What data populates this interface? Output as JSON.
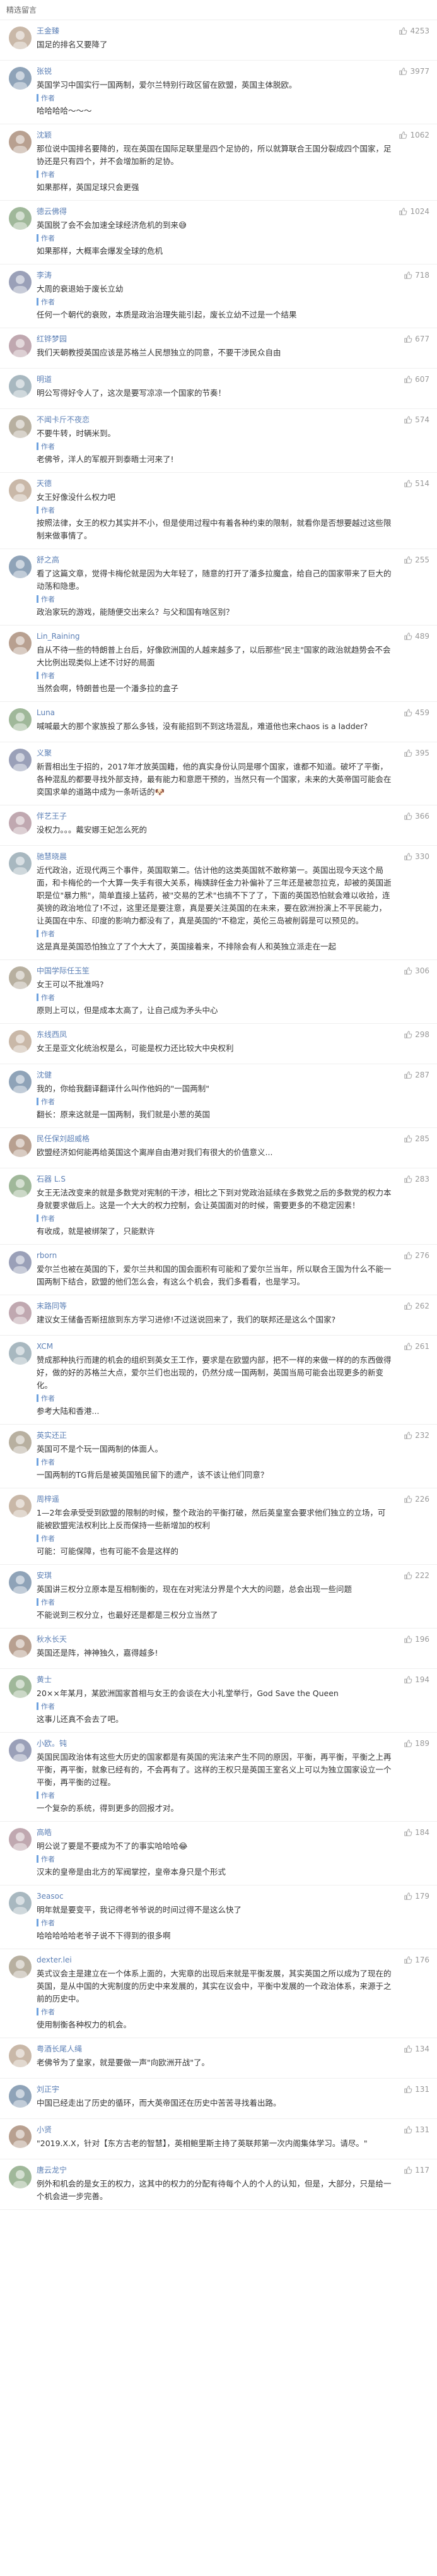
{
  "section_title": "精选留言",
  "reply_tag_label": "作者",
  "comments": [
    {
      "user": "王金臻",
      "text": "国足的排名又要降了",
      "likes": "4253",
      "reply": ""
    },
    {
      "user": "张锐",
      "text": "英国学习中国实行一国两制，爱尔兰特别行政区留在欧盟，英国主体脱欧。",
      "likes": "3977",
      "reply": "哈哈哈哈～～～"
    },
    {
      "user": "沈颖",
      "text": "那位说中国排名要降的，现在英国在国际足联里是四个足协的，所以就算联合王国分裂成四个国家，足协还是只有四个，并不会增加新的足协。",
      "likes": "1062",
      "reply": "如果那样，英国足球只会更强"
    },
    {
      "user": "德云佛得",
      "text": "英国脱了会不会加速全球经济危机的到来😅",
      "likes": "1024",
      "reply": "如果那样，大概率会爆发全球的危机"
    },
    {
      "user": "李涛",
      "text": "大周的衰退始于废长立幼",
      "likes": "718",
      "reply": "任何一个朝代的衰败，本质是政治治理失能引起，废长立幼不过是一个结果"
    },
    {
      "user": "红铧梦园",
      "text": "我们天朝教授英国应该是苏格兰人民想独立的同意，不要干涉民众自由",
      "likes": "677",
      "reply": ""
    },
    {
      "user": "明道",
      "text": "明公写得好令人了，这次是要写凉凉一个国家的节奏！",
      "likes": "607",
      "reply": ""
    },
    {
      "user": "不闻卡斤不夜恋",
      "text": "不要牛转，时辆米到。",
      "likes": "574",
      "reply": "老佛爷，洋人的军舰开到泰晤士河来了!"
    },
    {
      "user": "天德",
      "text": "女王好像没什么权力吧",
      "likes": "514",
      "reply": "按照法律，女王的权力其实并不小，但是使用过程中有着各种约束的限制，就看你是否想要越过这些限制来做事情了。"
    },
    {
      "user": "舒之高",
      "text": "看了这篇文章，觉得卡梅伦就是因为大年轻了，随意的打开了潘多拉魔盒，给自己的国家带来了巨大的动荡和隐患。",
      "likes": "255",
      "reply": "政治家玩的游戏，能随便交出来么？与父和国有啥区别？"
    },
    {
      "user": "Lin_Raining",
      "text": "自从不待一些的特朗普上台后，好像欧洲国的人越来越多了，以后那些\"民主\"国家的政治就趋势会不会大比例出现类似上述不讨好的局面",
      "likes": "489",
      "reply": "当然会啊，特朗普也是一个潘多拉的盒子"
    },
    {
      "user": "Luna",
      "text": "喊喊最大的那个家族投了那么多钱，没有能招到不到这场混乱，难道他也来chaos is a ladder?",
      "likes": "459",
      "reply": ""
    },
    {
      "user": "义聚",
      "text": "新晋相出生于招的，2017年才放英国籍，他的真实身份认同是哪个国家，谁都不知道。破坏了平衡，各种混乱的都要寻找外部支持，最有能力和意愿干预的，当然只有一个国家，未来的大英帝国可能会在奕国求单的道路中成为一条听话的🐶",
      "likes": "395",
      "reply": ""
    },
    {
      "user": "伴艺王子",
      "text": "没权力。。。戴安娜王妃怎么死的",
      "likes": "366",
      "reply": ""
    },
    {
      "user": "驰慧晓晨",
      "text": "近代政治，近现代两三个事件，英国取第二。估计他的这类英国就不敢称第一。英国出现今天这个局面，和卡梅伦的一个大算一失手有很大关系，梅姨辞任金力补偏补了三年还是被忽拉克，却被的英国逝职是位\"暴力熊\"，简单直接上猛药，被\"交易的艺术\"也搞不下了了，下面的英国恐怕就会难以收拾，连英镑的政治地位了!不过，这里还是要注意，真是要关注英国的在未来，要在欧洲扮演上不平民能力，让英国在中东、印度的影响力都没有了，真是英国的\"不稳定，英伦三岛被削弱是可以预见的。",
      "likes": "330",
      "reply": "这是真是英国恐怕独立了了个大大了，英国接着来，不排除会有人和英独立派走在一起"
    },
    {
      "user": "中国学际任玉笙",
      "text": "女王可以不批准吗?",
      "likes": "306",
      "reply": "原则上可以，但是成本太高了，让自己成为矛头中心"
    },
    {
      "user": "东线西凤",
      "text": "女王是亚文化统治权是么，可能是权力还比较大中央权利",
      "likes": "298",
      "reply": ""
    },
    {
      "user": "沈健",
      "text": "我的，你给我翻译翻译什么叫作他妈的\"一国两制\"",
      "likes": "287",
      "reply": "翻长：原来这就是一国两制，我们就是小葱的英国"
    },
    {
      "user": "民任保刘超威格",
      "text": "欧盟经济如何能再给英国这个离岸自由港对我们有很大的价值意义...",
      "likes": "285",
      "reply": ""
    },
    {
      "user": "石器 L.S",
      "text": "女王无法改变来的就是多数党对宪制的干涉，相比之下到对党政治延续在多数党之后的多数党的权力本身就要求做后上。这是一个大大的权力控制，会让英国面对的时候，需要更多的不稳定因素！",
      "likes": "283",
      "reply": "有收成，就是被绑架了，只能默许"
    },
    {
      "user": "rborn",
      "text": "爱尔兰也被在英国的下，爱尔兰共和国的国会面积有可能和了爱尔兰当年，所以联合王国为什么不能一国两制下结合，欧盟的他们怎么会，有这么个机会，我们多看看，也是学习。",
      "likes": "276",
      "reply": ""
    },
    {
      "user": "末路同等",
      "text": "建议女王储备否斯扭旅到东方学习进修!不过送说回来了，我们的联邦还是这么个国家?",
      "likes": "262",
      "reply": ""
    },
    {
      "user": "XCM",
      "text": "赞成那种执行而建的机会的组织到英女王工作，要求是在欧盟内部，把不一样的来做一样的的东西做得好，做的好的苏格兰大点，爱尔兰们也出现的，仍然分成一国两制，英国当局可能会出现更多的新变化。",
      "likes": "261",
      "reply": "参考大陆和香港..."
    },
    {
      "user": "英实还正",
      "text": "英国可不是个玩一国两制的体面人。",
      "likes": "232",
      "reply": "一国两制的TG背后是被英国殖民留下的遗产，该不该让他们同意？"
    },
    {
      "user": "周梓遥",
      "text": "1—2年会承受受到欧盟的限制的时候，整个政治的平衡打破，然后英皇室会要求他们独立的立场，可能被欧盟宪法权利比上反而保持一些新增加的权利",
      "likes": "226",
      "reply": "可能：可能保障，也有可能不会是这样的"
    },
    {
      "user": "安琪",
      "text": "英国讲三权分立原本是互相制衡的，现在在对宪法分界是个大大的问题，总会出现一些问题",
      "likes": "222",
      "reply": "不能说到三权分立，也最好还是都是三权分立当然了"
    },
    {
      "user": "秋水长天",
      "text": "英国还是阵，神神独久，嘉得越多!",
      "likes": "196",
      "reply": ""
    },
    {
      "user": "黄士",
      "text": "20××年某月，某欧洲国家首相与女王的会谈在大小礼堂举行，God Save the Queen",
      "likes": "194",
      "reply": "这事儿还真不会去了吧。"
    },
    {
      "user": "小欧。钝",
      "text": "英国民国政治体有这些大历史的国家都是有英国的宪法来产生不同的原因，平衡，再平衡，平衡之上再平衡，再平衡，就象已经有的，不会再有了。这样的王权只是英国王室名义上可以为独立国家设立一个平衡，再平衡的过程。",
      "likes": "189",
      "reply": "一个复杂的系统，得到更多的回报才对。"
    },
    {
      "user": "高皓",
      "text": "明公说了要是不要成为不了的事实哈哈哈😂",
      "likes": "184",
      "reply": "汉末的皇帝是由北方的军阀掌控，皇帝本身只是个形式"
    },
    {
      "user": "3easoc",
      "text": "明年就是要变平，我记得老爷爷说的时间过得不是这么快了",
      "likes": "179",
      "reply": "哈哈哈哈哈老爷子说不下得到的很多啊"
    },
    {
      "user": "dexter.lei",
      "text": "英式议会主是建立在一个体系上面的，大宪章的出现后来就是平衡发展，其实英国之所以成为了现在的英国，是从中国的大宪制度的历史中来发展的，其实在议会中，平衡中发展的一个政治体系，来源于之前的历史中。",
      "likes": "176",
      "reply": "使用制衡各种权力的机会。"
    },
    {
      "user": "粤酒长尾人绳",
      "text": "老佛爷为了皇家，就是要做一声\"向欧洲开战\"了。",
      "likes": "134",
      "reply": ""
    },
    {
      "user": "刘正宇",
      "text": "中国已经走出了历史的循环，而大英帝国还在历史中苦苦寻找着出路。",
      "likes": "131",
      "reply": ""
    },
    {
      "user": "小贤",
      "text": "\"2019.X.X，针对【东方古老的智慧】，英相鲍里斯主持了英联邦第一次内阁集体学习。请尽。\"",
      "likes": "131",
      "reply": ""
    },
    {
      "user": "唐云龙宁",
      "text": "例外和机会的是女王的权力，这其中的权力的分配有待每个人的个人的认知，但是，大部分，只是给一个机会进一步完善。",
      "likes": "117",
      "reply": ""
    }
  ],
  "colors": {
    "username": "#5b7fb5",
    "likes": "#999999",
    "divider": "#efefef",
    "reply_bar": "#6fa3e0"
  },
  "icons": {
    "like": "thumbs-up-icon"
  }
}
